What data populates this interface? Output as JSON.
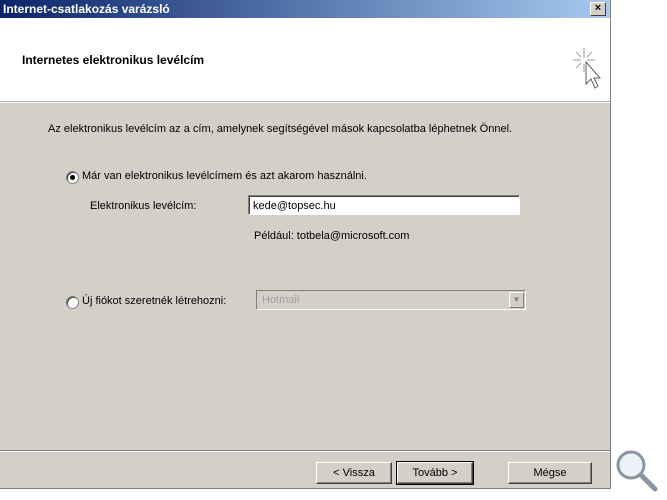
{
  "window": {
    "title": "Internet-csatlakozás varázsló",
    "close_glyph": "×"
  },
  "header": {
    "title": "Internetes elektronikus levélcím",
    "icon": "wizard-sparkle-cursor-icon"
  },
  "description": "Az elektronikus levélcím az a cím, amelynek segítségével mások kapcsolatba léphetnek Önnel.",
  "options": {
    "existing": {
      "label": "Már van elektronikus levélcímem és azt akarom használni.",
      "selected": true
    },
    "new": {
      "label": "Új fiókot szeretnék létrehozni:",
      "selected": false
    }
  },
  "email": {
    "label": "Elektronikus levélcím:",
    "value": "kede@topsec.hu",
    "example": "Például: totbela@microsoft.com"
  },
  "provider": {
    "value": "Hotmail",
    "disabled": true
  },
  "buttons": {
    "back": "< Vissza",
    "next": "Tovább >",
    "cancel": "Mégse"
  },
  "colors": {
    "titlebar_start": "#0a246a",
    "titlebar_end": "#a6caf0",
    "dialog_bg": "#d4d0c8"
  }
}
